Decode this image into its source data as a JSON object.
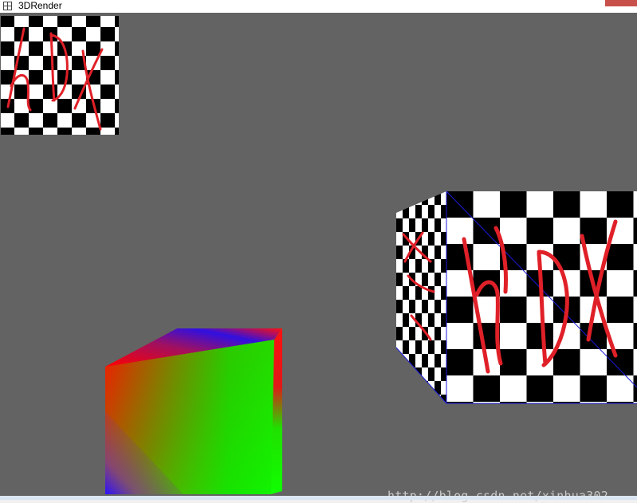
{
  "window": {
    "title": "3DRender"
  },
  "viewport": {
    "background": "#636363",
    "texture_text": "hDX",
    "watermark": "http://blog.csdn.net/xinhua302"
  },
  "colors": {
    "ink": "#e02028",
    "checker_dark": "#000000",
    "checker_light": "#ffffff"
  }
}
